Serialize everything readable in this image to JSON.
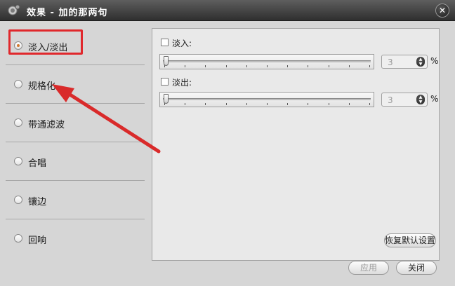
{
  "window": {
    "title": "效果 - 加的那两句",
    "close_glyph": "✕"
  },
  "sidebar": {
    "items": [
      {
        "label": "淡入/淡出",
        "checked": true
      },
      {
        "label": "规格化",
        "checked": false
      },
      {
        "label": "带通滤波",
        "checked": false
      },
      {
        "label": "合唱",
        "checked": false
      },
      {
        "label": "镶边",
        "checked": false
      },
      {
        "label": "回响",
        "checked": false
      }
    ]
  },
  "panel": {
    "fade_in": {
      "label": "淡入:",
      "checked": false,
      "value": "3",
      "unit": "%",
      "slider_fraction": 0
    },
    "fade_out": {
      "label": "淡出:",
      "checked": false,
      "value": "3",
      "unit": "%",
      "slider_fraction": 0
    },
    "restore_defaults_label": "恢复默认设置"
  },
  "footer": {
    "apply_label": "应用",
    "close_label": "关闭"
  },
  "icons": {
    "app": "speaker-icon",
    "spin": "spin-arrows-icon"
  },
  "colors": {
    "titlebar": "#3f3f3f",
    "highlight": "#e0282c",
    "radio_checked": "#d07a30"
  }
}
